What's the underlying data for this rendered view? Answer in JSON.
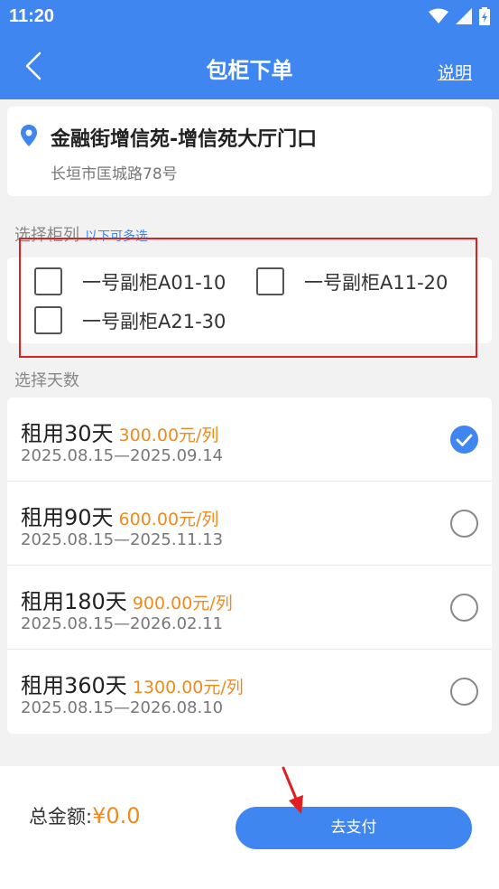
{
  "status_bar": {
    "time": "11:20",
    "icons": [
      "wifi-icon",
      "signal-icon",
      "battery-icon"
    ]
  },
  "nav": {
    "title": "包柜下单",
    "help_label": "说明",
    "back_icon": "chevron-left-icon"
  },
  "address": {
    "name": "金融街增信苑-增信苑大厅门口",
    "street": "长垣市匡城路78号",
    "icon": "location-pin-icon"
  },
  "locker_section": {
    "label": "选择柜列",
    "hint": "以下可多选",
    "options": [
      {
        "label": "一号副柜A01-10",
        "checked": false
      },
      {
        "label": "一号副柜A11-20",
        "checked": false
      },
      {
        "label": "一号副柜A21-30",
        "checked": false
      }
    ]
  },
  "days_section": {
    "label": "选择天数",
    "plans": [
      {
        "days": "租用30天",
        "price": "300.00元/列",
        "range": "2025.08.15—2025.09.14",
        "selected": true
      },
      {
        "days": "租用90天",
        "price": "600.00元/列",
        "range": "2025.08.15—2025.11.13",
        "selected": false
      },
      {
        "days": "租用180天",
        "price": "900.00元/列",
        "range": "2025.08.15—2026.02.11",
        "selected": false
      },
      {
        "days": "租用360天",
        "price": "1300.00元/列",
        "range": "2025.08.15—2026.08.10",
        "selected": false
      }
    ]
  },
  "footer": {
    "total_label": "总金额:",
    "total_value": "¥0.0",
    "pay_label": "去支付"
  },
  "colors": {
    "primary": "#3f86f0",
    "accent": "#f08a1c",
    "annotation": "#e02020"
  }
}
